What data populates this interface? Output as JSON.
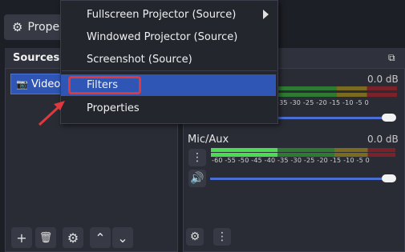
{
  "toolbar": {
    "properties_label": "Proper"
  },
  "sources": {
    "title": "Sources",
    "items": [
      {
        "label": "Video"
      }
    ],
    "footer": {
      "add": "+",
      "remove": "🗑",
      "settings": "⚙",
      "up": "⌃",
      "down": "⌄"
    }
  },
  "mixer": {
    "channels": [
      {
        "name": "",
        "db": "0.0 dB",
        "scale": "-35  -30  -25  -20  -15  -10   -5    0",
        "level": 0.82
      },
      {
        "name": "Mic/Aux",
        "db": "0.0 dB",
        "scale": "-60  -55  -50  -45  -40  -35  -30  -25  -20  -15  -10   -5    0",
        "level": 0.36
      }
    ]
  },
  "context_menu": {
    "items": [
      {
        "label": "Fullscreen Projector (Source)",
        "has_submenu": true
      },
      {
        "label": "Windowed Projector (Source)"
      },
      {
        "label": "Screenshot (Source)"
      },
      {
        "label": "Filters",
        "highlighted": true
      },
      {
        "label": "Properties"
      }
    ]
  },
  "colors": {
    "accent": "#2f56b4",
    "highlight_box": "#e0393d",
    "meter_green": "#4cdc54",
    "meter_yellow": "#d6c54a",
    "meter_red": "#d7434c"
  }
}
